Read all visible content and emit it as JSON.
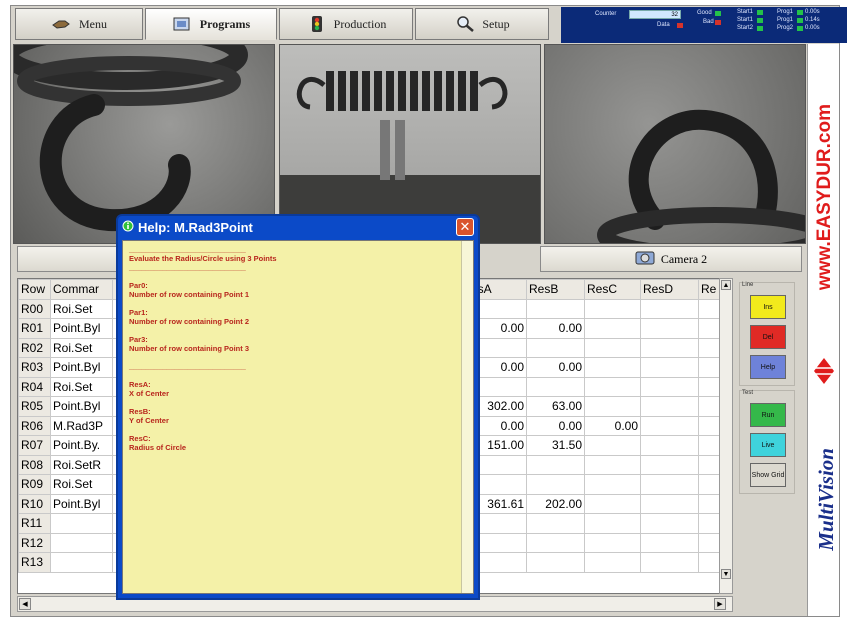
{
  "toolbar": {
    "tabs": [
      {
        "label": "Menu",
        "icon": "hand-icon"
      },
      {
        "label": "Programs",
        "icon": "programs-icon"
      },
      {
        "label": "Production",
        "icon": "traffic-light-icon"
      },
      {
        "label": "Setup",
        "icon": "magnifier-icon"
      }
    ],
    "active": "Programs"
  },
  "status": {
    "counter_label": "Counter",
    "counter_value": "32",
    "data_label": "Data",
    "good_label": "Good",
    "bad_label": "Bad",
    "starts": [
      "Start1",
      "Start1",
      "Start2"
    ],
    "progs": [
      {
        "label": "Prog1",
        "value": "0.00s"
      },
      {
        "label": "Prog1",
        "value": "0.14s"
      },
      {
        "label": "Prog2",
        "value": "0.00s"
      }
    ]
  },
  "camera_tabs": [
    "Camera 2"
  ],
  "grid": {
    "columns": [
      "Row",
      "Commar",
      "",
      "",
      "",
      "",
      "",
      "",
      "esA",
      "ResB",
      "ResC",
      "ResD",
      "Re"
    ],
    "rows": [
      {
        "row": "R00",
        "cmd": "Roi.Set",
        "a": "",
        "b": "",
        "c": ""
      },
      {
        "row": "R01",
        "cmd": "Point.Byl",
        "a": "0.00",
        "b": "0.00",
        "c": ""
      },
      {
        "row": "R02",
        "cmd": "Roi.Set",
        "a": "",
        "b": "",
        "c": ""
      },
      {
        "row": "R03",
        "cmd": "Point.Byl",
        "a": "0.00",
        "b": "0.00",
        "c": ""
      },
      {
        "row": "R04",
        "cmd": "Roi.Set",
        "a": "",
        "b": "",
        "c": ""
      },
      {
        "row": "R05",
        "cmd": "Point.Byl",
        "a": "302.00",
        "b": "63.00",
        "c": ""
      },
      {
        "row": "R06",
        "cmd": "M.Rad3P",
        "a": "0.00",
        "b": "0.00",
        "c": "0.00"
      },
      {
        "row": "R07",
        "cmd": "Point.By.",
        "a": "151.00",
        "b": "31.50",
        "c": ""
      },
      {
        "row": "R08",
        "cmd": "Roi.SetR",
        "a": "",
        "b": "",
        "c": ""
      },
      {
        "row": "R09",
        "cmd": "Roi.Set",
        "a": "",
        "b": "",
        "c": ""
      },
      {
        "row": "R10",
        "cmd": "Point.Byl",
        "a": "361.61",
        "b": "202.00",
        "c": ""
      },
      {
        "row": "R11",
        "cmd": "",
        "a": "",
        "b": "",
        "c": ""
      },
      {
        "row": "R12",
        "cmd": "",
        "a": "",
        "b": "",
        "c": ""
      },
      {
        "row": "R13",
        "cmd": "",
        "a": "",
        "b": "",
        "c": ""
      }
    ]
  },
  "buttons": {
    "line_label": "Line",
    "test_label": "Test",
    "ins": "Ins",
    "del": "Del",
    "help": "Help",
    "run": "Run",
    "live": "Live",
    "show_grid": "Show Grid"
  },
  "help": {
    "title": "Help: M.Rad3Point",
    "lines": [
      "____________________________",
      "Evaluate the Radius/Circle using 3 Points",
      "____________________________",
      "",
      "Par0:",
      "Number of row containing Point 1",
      "",
      "Par1:",
      "Number of row containing Point 2",
      "",
      "Par3:",
      "Number of row containing Point 3",
      "",
      "____________________________",
      "",
      "ResA:",
      "X of Center",
      "",
      "ResB:",
      "Y of Center",
      "",
      "ResC:",
      "Radius of Circle"
    ]
  },
  "brand": {
    "top": "www.EASYDUR.com",
    "bottom": "MultiVision"
  },
  "colors": {
    "dialog_blue": "#0b4ac8",
    "help_bg": "#f4f1a8",
    "help_text": "#b8261d",
    "ins": "#f2ea1c",
    "del": "#e02a25",
    "help_btn": "#6e82d9",
    "run": "#35b84a",
    "live": "#3fd3dc",
    "brand_red": "#e01c1c",
    "brand_blue": "#1a2f8a"
  }
}
